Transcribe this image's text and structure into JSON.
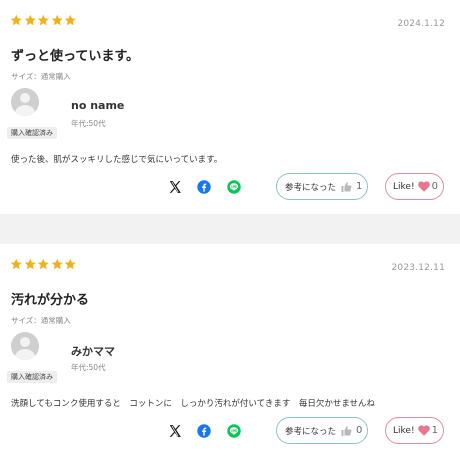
{
  "colors": {
    "star": "#f0b21c",
    "like_border": "#e98a9c",
    "heart": "#e8768f",
    "helpful_border": "#8fc3c3",
    "thumb": "#b9b9b9",
    "facebook": "#1877f2",
    "line": "#06c755"
  },
  "icons": {
    "star": "star-icon",
    "x": "x-logo-icon",
    "facebook": "facebook-icon",
    "line": "line-icon",
    "thumb": "thumbs-up-icon",
    "heart": "heart-icon",
    "avatar": "user-avatar-icon"
  },
  "reviews": [
    {
      "rating": 5,
      "date": "2024.1.12",
      "title": "ずっと使っています。",
      "size": "サイズ：通常購入",
      "name": "no name",
      "age": "年代:50代",
      "verified": "購入確認済み",
      "body": "使った後、肌がスッキリした感じで気にいっています。",
      "helpful_label": "参考になった",
      "helpful_count": "1",
      "like_label": "Like!",
      "like_count": "0"
    },
    {
      "rating": 5,
      "date": "2023.12.11",
      "title": "汚れが分かる",
      "size": "サイズ：通常購入",
      "name": "みかママ",
      "age": "年代:50代",
      "verified": "購入確認済み",
      "body": "洗顔してもコンク使用すると　コットンに　しっかり汚れが付いてきます　毎日欠かせませんね",
      "helpful_label": "参考になった",
      "helpful_count": "0",
      "like_label": "Like!",
      "like_count": "1"
    }
  ]
}
